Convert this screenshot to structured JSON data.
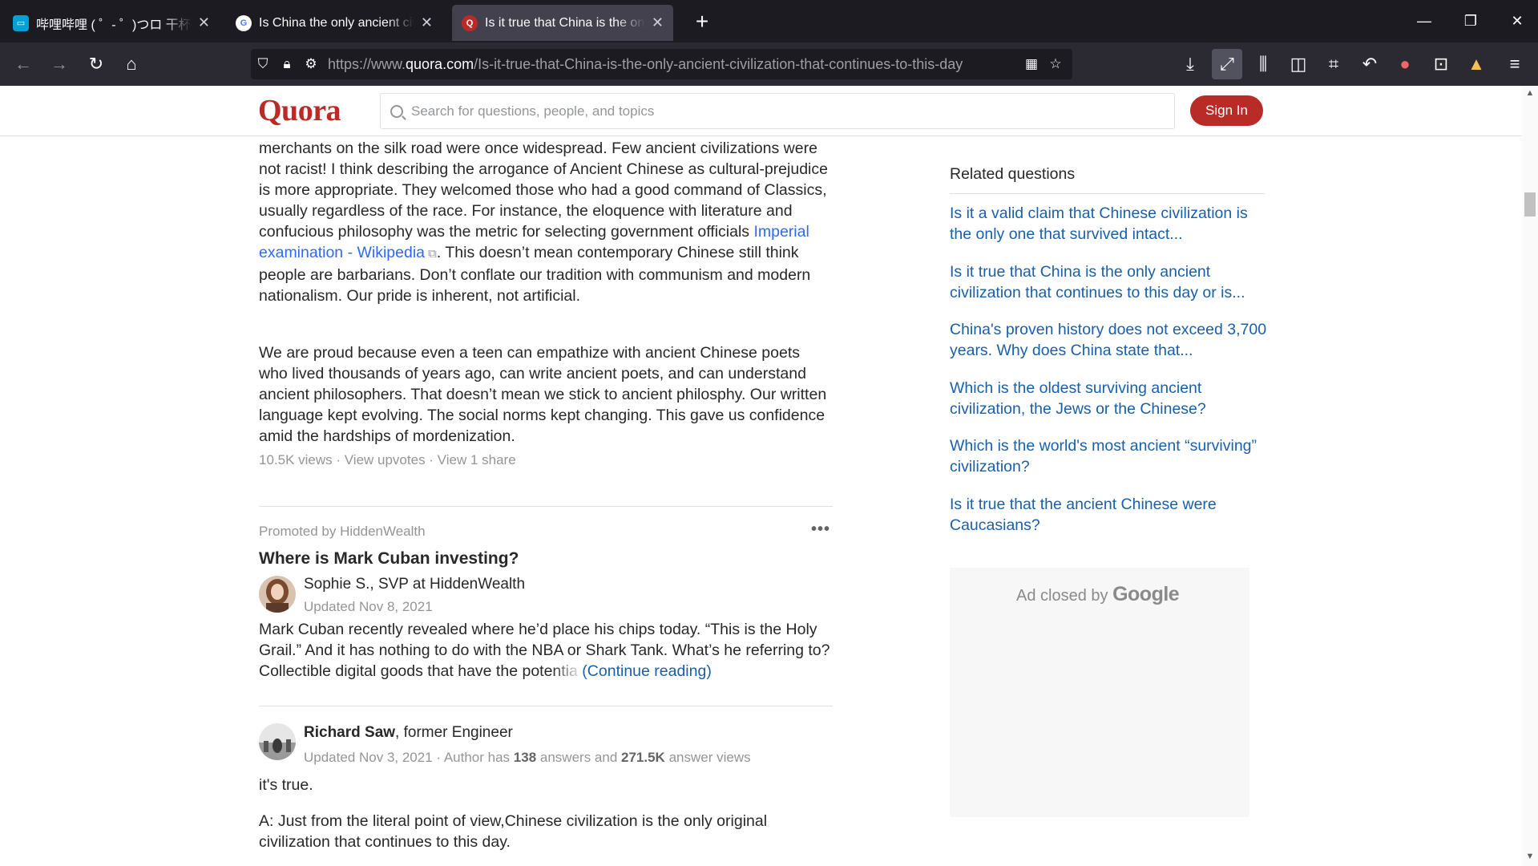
{
  "browser": {
    "tabs": [
      {
        "title": "哔哩哔哩 ( ゜- ゜)つロ 干杯~-bilibili",
        "favicon": "bilibili-icon",
        "active": false
      },
      {
        "title": "Is China the only ancient civilization",
        "favicon": "google-icon",
        "active": false
      },
      {
        "title": "Is it true that China is the only ancient",
        "favicon": "quora-icon",
        "active": true
      }
    ],
    "url_prefix": "https://www.",
    "url_domain": "quora.com",
    "url_path": "/Is-it-true-that-China-is-the-only-ancient-civilization-that-continues-to-this-day"
  },
  "header": {
    "logo": "Quora",
    "search_placeholder": "Search for questions, people, and topics",
    "signin": "Sign In"
  },
  "answer1": {
    "p1_a": "merchants on the silk road were once widespread. Few ancient civilizations were not racist! I think describing the arrogance of Ancient Chinese as cultural-prejudice is more appropriate. They welcomed those who had a good command of Classics, usually regardless of the race. For instance, the eloquence with literature and confucious philosophy was the metric for selecting government officials ",
    "p1_link": "Imperial examination - Wikipedia",
    "p1_b": ". This doesn’t mean contemporary Chinese still think people are barbarians. Don’t conflate our tradition with communism and modern nationalism. Our pride is inherent, not artificial.",
    "p2": "We are proud because even a teen can empathize with ancient Chinese poets who lived thousands of years ago, can write ancient poets, and can understand ancient philosophers. That doesn’t mean we stick to ancient philosphy. Our written language kept evolving. The social norms kept changing. This gave us confidence amid the hardships of mordenization.",
    "stats": "10.5K views · View upvotes · View 1 share"
  },
  "promo": {
    "label": "Promoted by HiddenWealth",
    "title": "Where is Mark Cuban investing?",
    "author": "Sophie S., SVP at HiddenWealth",
    "date": "Updated Nov 8, 2021",
    "text_a": "Mark Cuban recently revealed where he’d place his chips today. “This is the Holy Grail.” And it has nothing to do with the NBA or Shark Tank. What’s he referring to? Collectible digital goods that have the ",
    "text_fade": "potentia",
    "continue": "(Continue reading)"
  },
  "answer2": {
    "author_name": "Richard Saw",
    "author_cred": ", former Engineer",
    "date_a": "Updated Nov 3, 2021 · Author has ",
    "answers": "138",
    "date_b": " answers and ",
    "views": "271.5K",
    "date_c": " answer views",
    "p1": "it's true.",
    "p2": "A: Just from the literal point of view,Chinese civilization is the only original civilization that continues to this day."
  },
  "related": {
    "title": "Related questions",
    "items": [
      "Is it a valid claim that Chinese civilization is the only one that survived intact...",
      "Is it true that China is the only ancient civilization that continues to this day or is...",
      "China's proven history does not exceed 3,700 years. Why does China state that...",
      "Which is the oldest surviving ancient civilization, the Jews or the Chinese?",
      "Which is the world's most ancient “surviving” civilization?",
      "Is it true that the ancient Chinese were Caucasians?"
    ]
  },
  "ad": {
    "closed_by": "Ad closed by ",
    "google": "Google"
  }
}
